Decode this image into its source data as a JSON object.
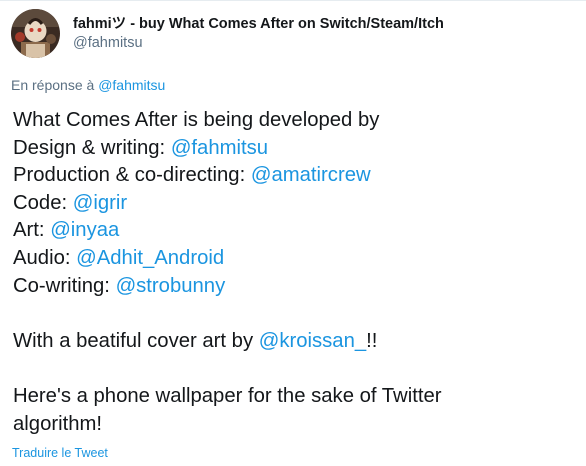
{
  "author": {
    "display_name": "fahmiツ - buy What Comes After on Switch/Steam/Itch",
    "handle": "@fahmitsu",
    "avatar_icon": "profile-avatar"
  },
  "reply": {
    "prefix": "En réponse à",
    "mention": "@fahmitsu"
  },
  "body": {
    "intro": "What Comes After is being developed by",
    "credits": [
      {
        "role": "Design & writing:",
        "mention": "@fahmitsu"
      },
      {
        "role": "Production & co-directing:",
        "mention": "@amatircrew"
      },
      {
        "role": "Code:",
        "mention": "@igrir"
      },
      {
        "role": "Art:",
        "mention": "@inyaa"
      },
      {
        "role": "Audio:",
        "mention": "@Adhit_Android"
      },
      {
        "role": "Co-writing:",
        "mention": "@strobunny"
      }
    ],
    "cover": {
      "prefix": "With a beatiful cover art by",
      "mention": "@kroissan_",
      "suffix": "!!"
    },
    "wallpaper_line1": "Here's a phone wallpaper for the sake of Twitter",
    "wallpaper_line2": "algorithm!"
  },
  "translate_link": "Traduire le Tweet",
  "colors": {
    "link": "#1b95e0",
    "text": "#14171a",
    "secondary": "#5b7083"
  }
}
